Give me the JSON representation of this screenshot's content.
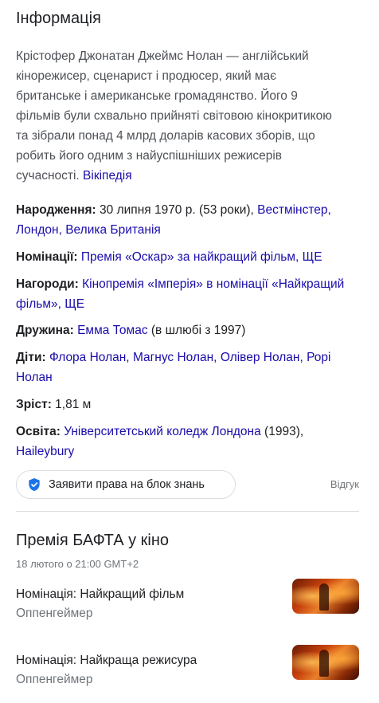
{
  "panel": {
    "title": "Інформація",
    "description": "Крістофер Джонатан Джеймс Нолан — англійський кінорежисер, сценарист і продюсер, який має британське і американське громадянство. Його 9 фільмів були схвально прийняті світовою кінокритикою та зібрали понад 4 млрд доларів касових зборів, що робить його одним з найуспішніших режисерів сучасності.",
    "source_link": "Вікіпедія"
  },
  "facts": {
    "born": {
      "label": "Народження:",
      "text": "30 липня 1970 р. (53 роки),",
      "links": [
        "Вестмінстер,",
        "Лондон,",
        "Велика Британія"
      ]
    },
    "nominations": {
      "label": "Номінації:",
      "links": [
        "Премія «Оскар» за найкращий фільм,",
        "ЩЕ"
      ]
    },
    "awards": {
      "label": "Нагороди:",
      "links": [
        "Кінопремія «Імперія» в номінації «Найкращий фільм»,",
        "ЩЕ"
      ]
    },
    "spouse": {
      "label": "Дружина:",
      "link": "Емма Томас",
      "text": "(в шлюбі з 1997)"
    },
    "children": {
      "label": "Діти:",
      "links": [
        "Флора Нолан,",
        "Магнус Нолан,",
        "Олівер Нолан,",
        "Рорі Нолан"
      ]
    },
    "height": {
      "label": "Зріст:",
      "text": "1,81 м"
    },
    "education": {
      "label": "Освіта:",
      "link1": "Університетський коледж Лондона",
      "text": "(1993),",
      "link2": "Haileybury"
    }
  },
  "claim": {
    "label": "Заявити права на блок знань",
    "icon": "verified-shield-icon",
    "feedback": "Відгук"
  },
  "event": {
    "title": "Премія БАФТА у кіно",
    "date": "18 лютого о 21:00 GMT+2",
    "items": [
      {
        "label": "Номінація: Найкращий фільм",
        "film": "Оппенгеймер"
      },
      {
        "label": "Номінація: Найкраща режисура",
        "film": "Оппенгеймер"
      }
    ]
  },
  "colors": {
    "link": "#1a0dab",
    "text": "#202124",
    "muted": "#70757a",
    "shield": "#1a73e8"
  }
}
